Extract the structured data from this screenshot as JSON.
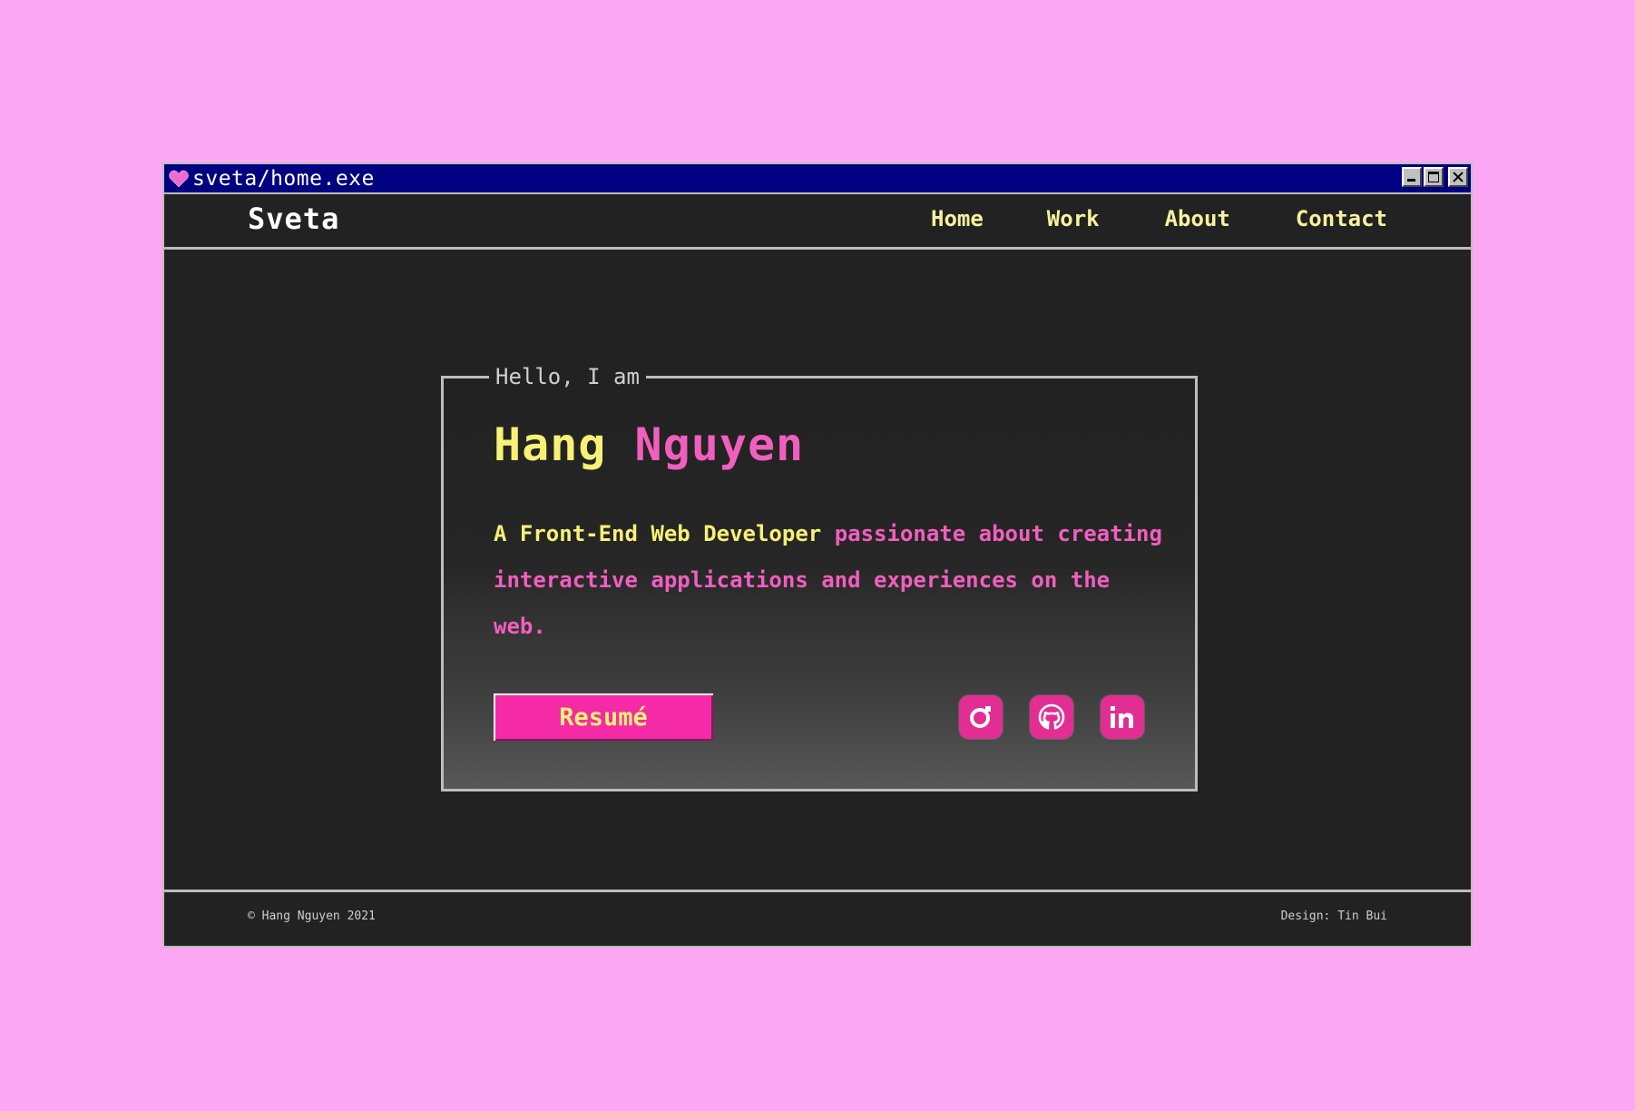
{
  "window": {
    "title": "sveta/home.exe",
    "title_icon": "heart-icon"
  },
  "nav": {
    "brand": "Sveta",
    "links": [
      "Home",
      "Work",
      "About",
      "Contact"
    ]
  },
  "hero": {
    "greeting": "Hello, I am",
    "first_name": "Hang",
    "last_name": "Nguyen",
    "description_highlight": "A Front-End Web Developer",
    "description_rest": "passionate about creating interactive applications and experiences on the web.",
    "resume_label": "Resumé",
    "social_icons": [
      "instagram-icon",
      "github-icon",
      "linkedin-icon"
    ]
  },
  "footer": {
    "copyright": "© Hang Nguyen 2021",
    "credit": "Design: Tin Bui"
  },
  "colors": {
    "background": "#fca7f4",
    "window": "#222222",
    "titlebar": "#000080",
    "yellow": "#f7f175",
    "pink": "#f15fbe",
    "button": "#f42aa7"
  }
}
